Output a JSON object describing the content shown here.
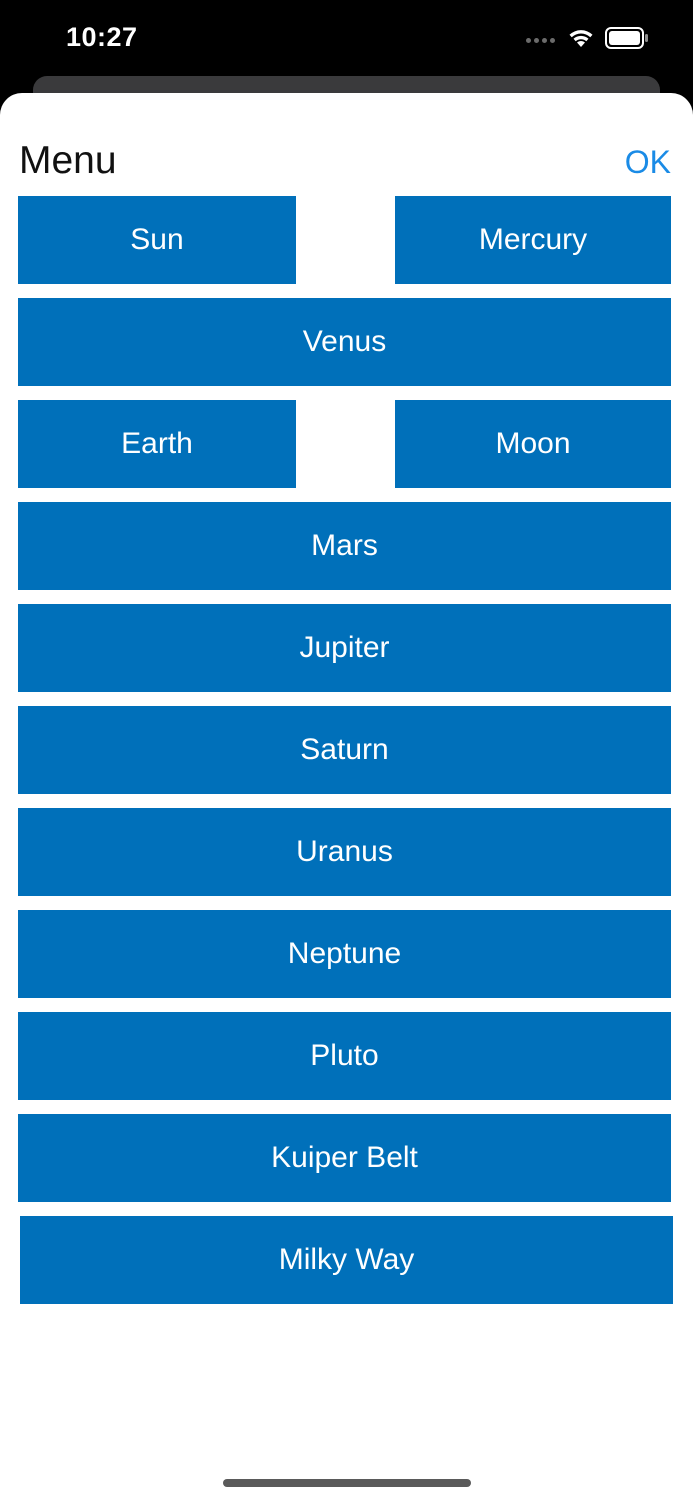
{
  "status_bar": {
    "time": "10:27"
  },
  "header": {
    "title": "Menu",
    "ok_label": "OK"
  },
  "menu": {
    "sun": "Sun",
    "mercury": "Mercury",
    "venus": "Venus",
    "earth": "Earth",
    "moon": "Moon",
    "mars": "Mars",
    "jupiter": "Jupiter",
    "saturn": "Saturn",
    "uranus": "Uranus",
    "neptune": "Neptune",
    "pluto": "Pluto",
    "kuiper_belt": "Kuiper Belt",
    "milky_way": "Milky Way"
  },
  "colors": {
    "button_bg": "#0070ba",
    "button_text": "#ffffff",
    "ok_accent": "#1a8be6"
  }
}
